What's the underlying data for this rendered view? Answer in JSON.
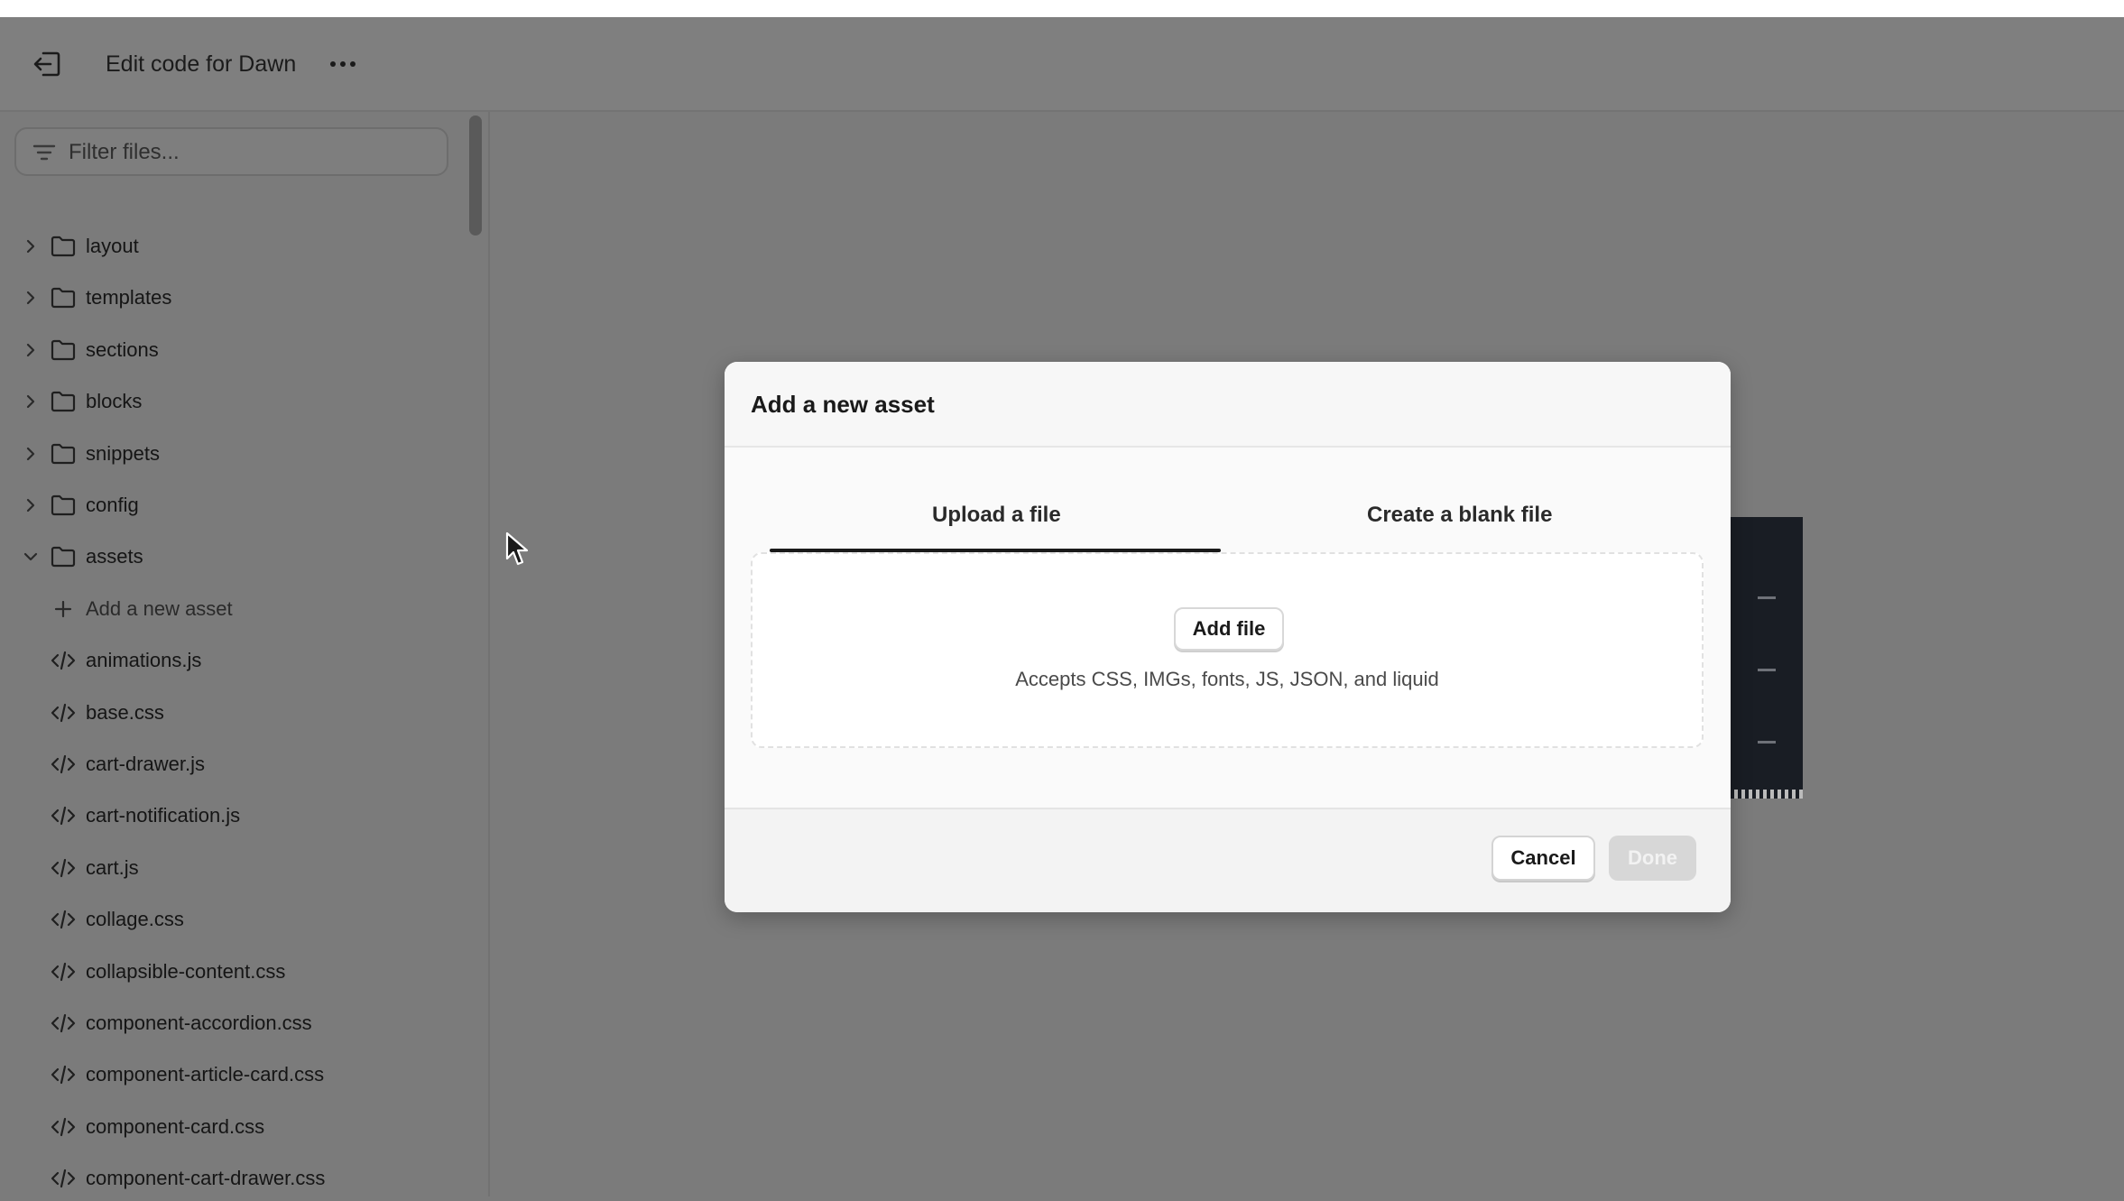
{
  "header": {
    "title": "Edit code for Dawn",
    "exit_icon": "exit-icon",
    "more_icon": "more-horizontal-icon"
  },
  "sidebar": {
    "filter_placeholder": "Filter files...",
    "folders": [
      {
        "label": "layout",
        "expanded": false
      },
      {
        "label": "templates",
        "expanded": false
      },
      {
        "label": "sections",
        "expanded": false
      },
      {
        "label": "blocks",
        "expanded": false
      },
      {
        "label": "snippets",
        "expanded": false
      },
      {
        "label": "config",
        "expanded": false
      },
      {
        "label": "assets",
        "expanded": true
      }
    ],
    "add_asset_label": "Add a new asset",
    "files": [
      "animations.js",
      "base.css",
      "cart-drawer.js",
      "cart-notification.js",
      "cart.js",
      "collage.css",
      "collapsible-content.css",
      "component-accordion.css",
      "component-article-card.css",
      "component-card.css",
      "component-cart-drawer.css"
    ]
  },
  "dialog": {
    "title": "Add a new asset",
    "tabs": [
      {
        "label": "Upload a file",
        "selected": true
      },
      {
        "label": "Create a blank file",
        "selected": false
      }
    ],
    "add_file_label": "Add file",
    "accepts_text": "Accepts CSS, IMGs, fonts, JS, JSON, and liquid",
    "cancel_label": "Cancel",
    "done_label": "Done",
    "done_enabled": false
  },
  "colors": {
    "overlay_bg": "#7b7b7b",
    "dialog_bg": "#fafafa",
    "tab_underline": "#1a1a1a",
    "done_disabled": "#d7d7d7"
  }
}
